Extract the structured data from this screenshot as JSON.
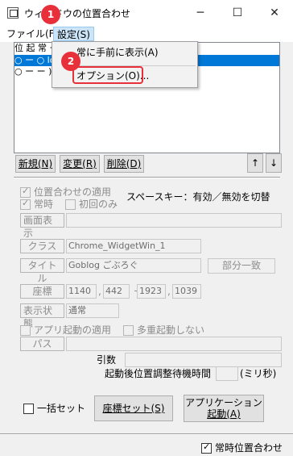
{
  "window": {
    "title": "ウィンドウの位置合わせ",
    "minimize_glyph": "─",
    "maximize_glyph": "☐",
    "close_glyph": "✕"
  },
  "menubar": {
    "file": "ファイル(F)",
    "settings": "設定(S)"
  },
  "dropdown": {
    "always_on_top": "常に手前に表示(A)",
    "options": "オプション(O)..."
  },
  "annotations": {
    "step1": "1",
    "step2": "2"
  },
  "list": {
    "header": "位 起 常                                  ーションパス]",
    "rows": [
      {
        "text": "○ ー ○                                           log ごぶろぐ )",
        "selected": true
      },
      {
        "text": "○ ー ー                                            )",
        "selected": false
      }
    ]
  },
  "list_buttons": {
    "new": "新規(N)",
    "change": "変更(R)",
    "delete": "削除(D)",
    "up": "↑",
    "down": "↓"
  },
  "settings": {
    "apply_position": "位置合わせの適用",
    "always": "常時",
    "first_only": "初回のみ",
    "space_key_hint": "スペースキー：有効／無効を切替",
    "screen_display": "画面表示",
    "class_label": "クラス",
    "class_value": "Chrome_WidgetWin_1",
    "title_label": "タイトル",
    "title_value": "Goblog ごぶろぐ",
    "partial_match": "部分一致",
    "coords_label": "座標",
    "x": "1140",
    "y": "442",
    "w": "1923",
    "h": "1039",
    "comma": ",",
    "dash": "ー",
    "state_label": "表示状態",
    "state_value": "通常",
    "apply_app_launch": "アプリ起動の適用",
    "no_multi_launch": "多重起動しない",
    "path_label": "パス",
    "args_label": "引数",
    "wait_label": "起動後位置調整待機時間",
    "wait_unit": "(ミリ秒)"
  },
  "bottom": {
    "bulk_set": "一括セット",
    "set_coords": "座標セット(S)",
    "launch_app_line1": "アプリケーション",
    "launch_app_line2": "起動(A)",
    "always_align": "常時位置合わせ"
  },
  "colors": {
    "highlight": "#e8303a",
    "selection": "#0078d7",
    "menu_active": "#cce4f7"
  }
}
